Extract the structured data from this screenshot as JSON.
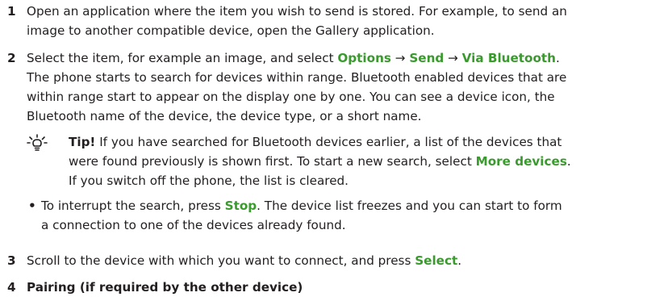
{
  "steps": [
    {
      "number": "1",
      "lines": [
        "Open an application where the item you wish to send is stored. For example, to send an",
        "image to another compatible device, open the Gallery application."
      ]
    },
    {
      "number": "2",
      "line1_text": "Select the item, for example an image, and select ",
      "options": "Options",
      "arrow": "→",
      "send": "Send",
      "via_bluetooth": "Via Bluetooth",
      "period": ".",
      "lines": [
        "The phone starts to search for devices within range. Bluetooth enabled devices that are",
        "within range start to appear on the display one by one. You can see a device icon, the",
        "Bluetooth name of the device, the device type, or a short name."
      ]
    },
    {
      "number": "3",
      "text": "Scroll to the device with which you want to connect, and press ",
      "select": "Select",
      "period": "."
    },
    {
      "number": "4",
      "heading": "Pairing (if required by the other device)"
    }
  ],
  "tip": {
    "label": "Tip!",
    "line1": " If you have searched for Bluetooth devices earlier, a list of the devices that",
    "line2": "were found previously is shown first. To start a new search, select ",
    "more_devices": "More devices",
    "period": ".",
    "line3": "If you switch off the phone, the list is cleared."
  },
  "bullet": {
    "dot": "•",
    "line1_a": "To interrupt the search, press ",
    "stop": "Stop",
    "line1_b": ". The device list freezes and you can start to form",
    "line2": "a connection to one of the devices already found."
  },
  "colors": {
    "ui_label": "#3a9a2e",
    "text": "#231f20"
  }
}
